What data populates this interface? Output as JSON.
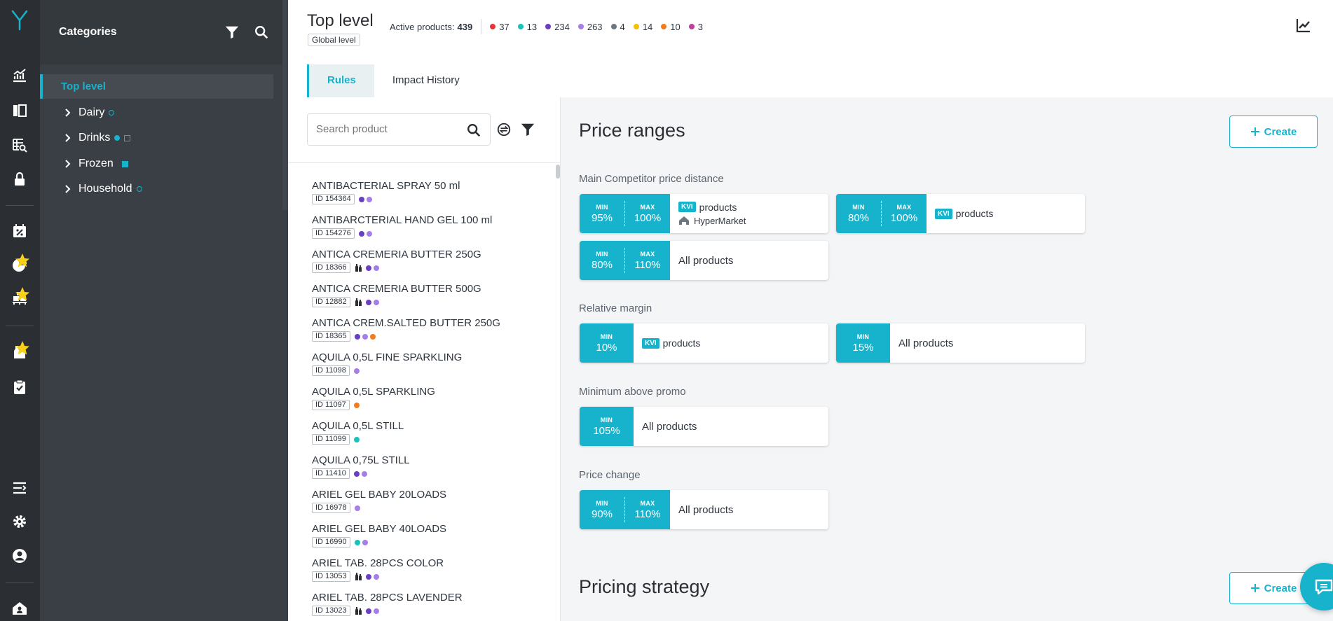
{
  "nav": {
    "logo": "Y-logo",
    "icons": [
      "dashboard-chart-icon",
      "columns-icon",
      "table-search-icon",
      "lock-icon",
      "percent-calendar-icon",
      "pie-chart-icon",
      "pallet-boxes-icon",
      "bottles-icon",
      "clipboard-check-icon",
      "collapse-menu-icon",
      "gear-icon",
      "user-circle-icon",
      "home-user-icon"
    ]
  },
  "categories": {
    "title": "Categories",
    "selected": "Top level",
    "items": [
      {
        "label": "Dairy"
      },
      {
        "label": "Drinks"
      },
      {
        "label": "Frozen"
      },
      {
        "label": "Household"
      }
    ]
  },
  "header": {
    "title": "Top level",
    "badge": "Global level",
    "active_label": "Active products:",
    "active_count": "439",
    "stats": [
      {
        "value": "37",
        "color": "#e5333b"
      },
      {
        "value": "13",
        "color": "#17c3b8"
      },
      {
        "value": "234",
        "color": "#6a3fc3"
      },
      {
        "value": "263",
        "color": "#a57ee8"
      },
      {
        "value": "4",
        "color": "#6e7781"
      },
      {
        "value": "14",
        "color": "#f2c200"
      },
      {
        "value": "10",
        "color": "#f07c1b"
      },
      {
        "value": "3",
        "color": "#c23d9c"
      }
    ],
    "tabs": [
      "Rules",
      "Impact History"
    ]
  },
  "search": {
    "placeholder": "Search product"
  },
  "products": [
    {
      "name": "ANTIBACTERIAL SPRAY 50 ml",
      "id": "ID 154364",
      "bottles": false,
      "dots": [
        "#6a3fc3",
        "#a57ee8"
      ]
    },
    {
      "name": "ANTIBARCTERIAL HAND GEL 100 ml",
      "id": "ID 154276",
      "bottles": false,
      "dots": [
        "#6a3fc3",
        "#a57ee8"
      ]
    },
    {
      "name": "ANTICA CREMERIA BUTTER 250G",
      "id": "ID 18366",
      "bottles": true,
      "dots": [
        "#6a3fc3",
        "#a57ee8"
      ]
    },
    {
      "name": "ANTICA CREMERIA BUTTER 500G",
      "id": "ID 12882",
      "bottles": true,
      "dots": [
        "#6a3fc3",
        "#a57ee8"
      ]
    },
    {
      "name": "ANTICA CREM.SALTED BUTTER 250G",
      "id": "ID 18365",
      "bottles": false,
      "dots": [
        "#6a3fc3",
        "#a57ee8",
        "#f07c1b"
      ]
    },
    {
      "name": "AQUILA 0,5L FINE SPARKLING",
      "id": "ID 11098",
      "bottles": false,
      "dots": [
        "#a57ee8"
      ]
    },
    {
      "name": "AQUILA 0,5L SPARKLING",
      "id": "ID 11097",
      "bottles": false,
      "dots": [
        "#f07c1b"
      ]
    },
    {
      "name": "AQUILA 0,5L STILL",
      "id": "ID 11099",
      "bottles": false,
      "dots": [
        "#17c3b8"
      ]
    },
    {
      "name": "AQUILA 0,75L STILL",
      "id": "ID 11410",
      "bottles": false,
      "dots": [
        "#6a3fc3",
        "#a57ee8"
      ]
    },
    {
      "name": "ARIEL GEL BABY 20LOADS",
      "id": "ID 16978",
      "bottles": false,
      "dots": [
        "#a57ee8"
      ]
    },
    {
      "name": "ARIEL GEL BABY 40LOADS",
      "id": "ID 16990",
      "bottles": false,
      "dots": [
        "#17c3b8",
        "#a57ee8"
      ]
    },
    {
      "name": "ARIEL TAB. 28PCS COLOR",
      "id": "ID 13053",
      "bottles": true,
      "dots": [
        "#6a3fc3",
        "#a57ee8"
      ]
    },
    {
      "name": "ARIEL TAB. 28PCS LAVENDER",
      "id": "ID 13023",
      "bottles": true,
      "dots": [
        "#6a3fc3",
        "#a57ee8"
      ]
    }
  ],
  "rules": {
    "price_ranges_title": "Price ranges",
    "create_label": "Create",
    "min_label": "MIN",
    "max_label": "MAX",
    "kvi_label": "KVI",
    "products_word": "products",
    "competitor_store": "HyperMarket",
    "all_products": "All products",
    "groups": {
      "competitor": "Main Competitor price distance",
      "margin": "Relative margin",
      "promo": "Minimum above promo",
      "change": "Price change"
    },
    "cards": {
      "c1": {
        "min": "95%",
        "max": "100%"
      },
      "c2": {
        "min": "80%",
        "max": "100%"
      },
      "c3": {
        "min": "80%",
        "max": "110%"
      },
      "m1": {
        "min": "10%"
      },
      "m2": {
        "min": "15%"
      },
      "p1": {
        "min": "105%"
      },
      "ch1": {
        "min": "90%",
        "max": "110%"
      }
    },
    "strategy_title": "Pricing strategy"
  }
}
